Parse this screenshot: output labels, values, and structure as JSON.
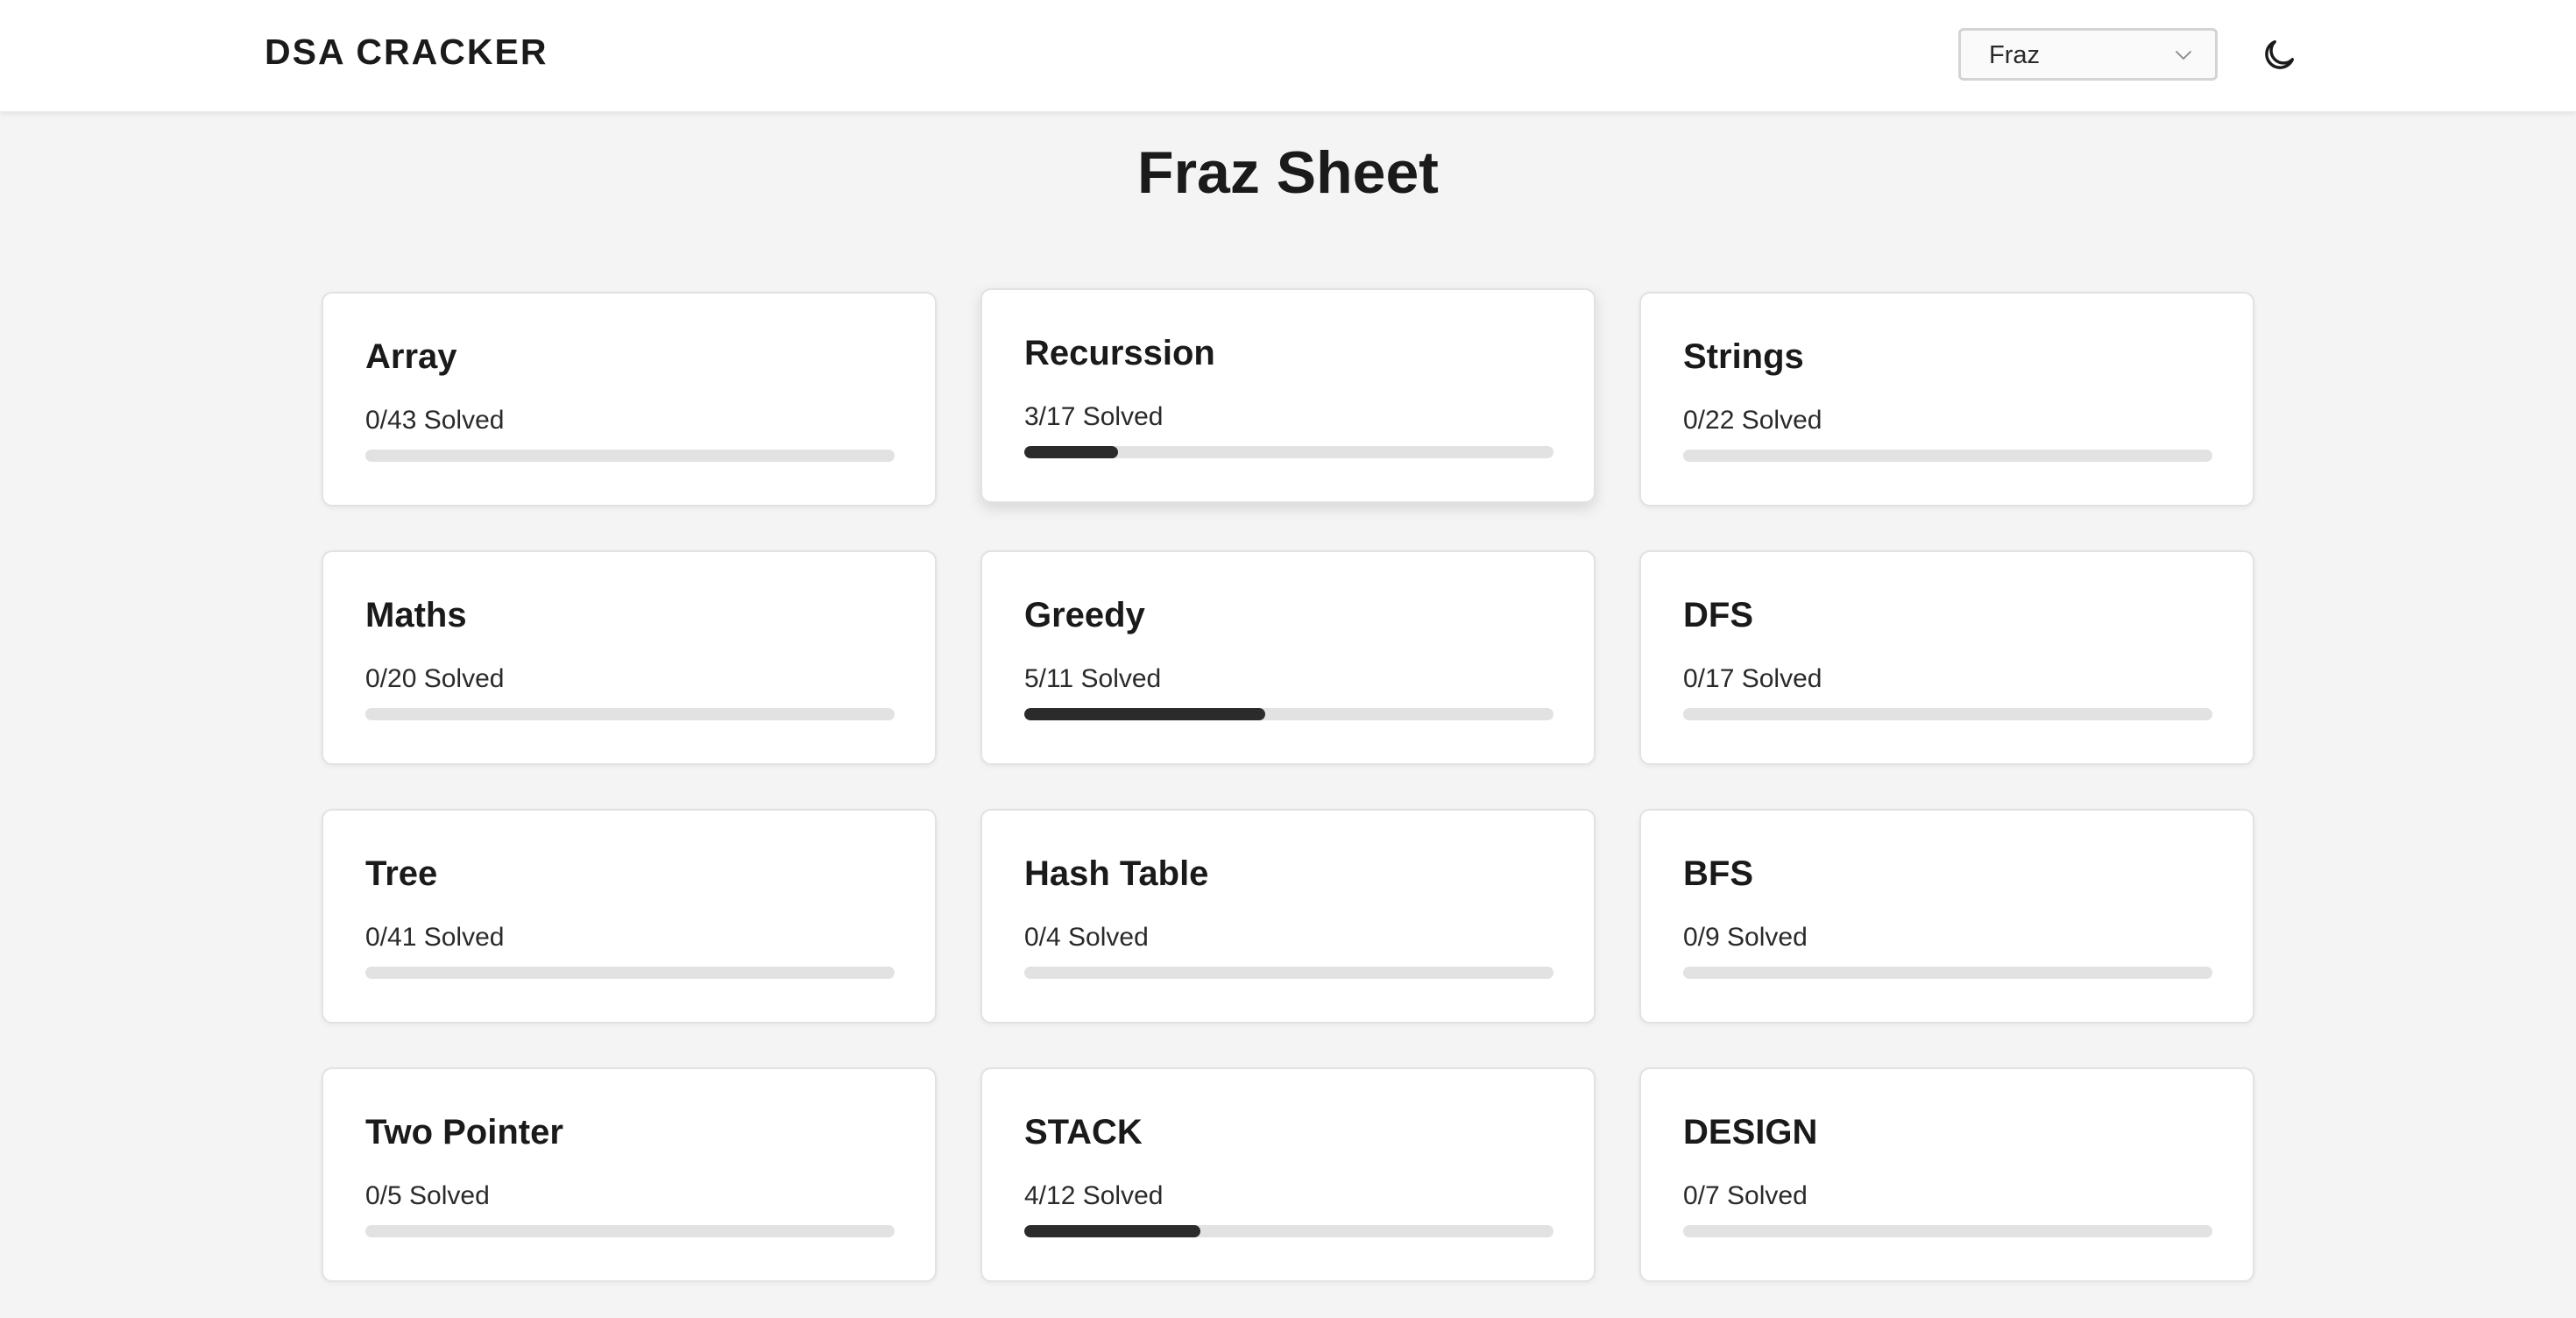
{
  "header": {
    "brand": "DSA CRACKER",
    "sheet_select": {
      "value": "Fraz"
    },
    "theme_toggle_icon": "moon-icon"
  },
  "page": {
    "title": "Fraz Sheet"
  },
  "topics": [
    {
      "name": "Array",
      "solved": 0,
      "total": 43,
      "label": "0/43 Solved"
    },
    {
      "name": "Recurssion",
      "solved": 3,
      "total": 17,
      "label": "3/17 Solved"
    },
    {
      "name": "Strings",
      "solved": 0,
      "total": 22,
      "label": "0/22 Solved"
    },
    {
      "name": "Maths",
      "solved": 0,
      "total": 20,
      "label": "0/20 Solved"
    },
    {
      "name": "Greedy",
      "solved": 5,
      "total": 11,
      "label": "5/11 Solved"
    },
    {
      "name": "DFS",
      "solved": 0,
      "total": 17,
      "label": "0/17 Solved"
    },
    {
      "name": "Tree",
      "solved": 0,
      "total": 41,
      "label": "0/41 Solved"
    },
    {
      "name": "Hash Table",
      "solved": 0,
      "total": 4,
      "label": "0/4 Solved"
    },
    {
      "name": "BFS",
      "solved": 0,
      "total": 9,
      "label": "0/9 Solved"
    },
    {
      "name": "Two Pointer",
      "solved": 0,
      "total": 5,
      "label": "0/5 Solved"
    },
    {
      "name": "STACK",
      "solved": 4,
      "total": 12,
      "label": "4/12 Solved"
    },
    {
      "name": "DESIGN",
      "solved": 0,
      "total": 7,
      "label": "0/7 Solved"
    }
  ],
  "colors": {
    "progress_fill": "#2b2b2b",
    "progress_track": "#e2e2e2",
    "background": "#f4f4f4"
  }
}
